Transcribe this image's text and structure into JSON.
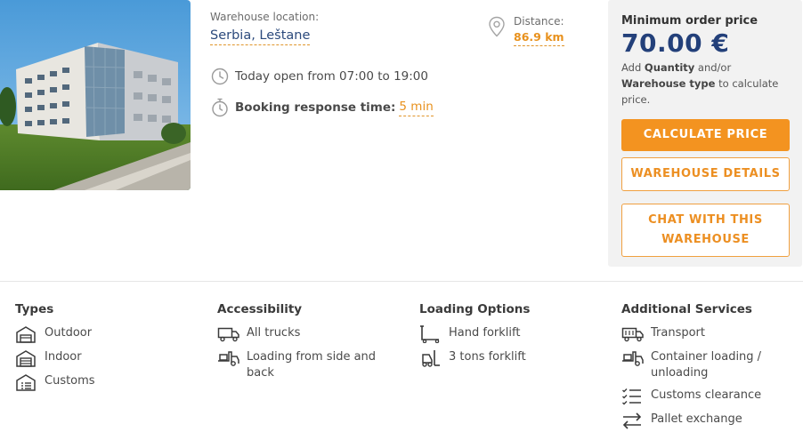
{
  "listing": {
    "location_label": "Warehouse location:",
    "location_value": "Serbia, Leštane",
    "distance_label": "Distance:",
    "distance_value": "86.9 km",
    "open_hours": "Today open from 07:00 to 19:00",
    "booking_label": "Booking response time:",
    "booking_value": "5 min",
    "icons": {
      "pin": "map-pin-icon",
      "clock": "clock-icon",
      "stopwatch": "stopwatch-icon"
    }
  },
  "pricing": {
    "min_label": "Minimum order price",
    "price": "70.00 €",
    "hint_prefix": "Add ",
    "hint_quantity": "Quantity",
    "hint_middle": " and/or ",
    "hint_type": "Warehouse type",
    "hint_suffix": " to calculate price.",
    "calculate_button": "CALCULATE PRICE",
    "details_button": "WAREHOUSE DETAILS",
    "chat_button": "CHAT WITH THIS WAREHOUSE"
  },
  "features": {
    "types": {
      "title": "Types",
      "items": [
        "Outdoor",
        "Indoor",
        "Customs"
      ]
    },
    "accessibility": {
      "title": "Accessibility",
      "items": [
        "All trucks",
        "Loading from side and back"
      ]
    },
    "loading": {
      "title": "Loading Options",
      "items": [
        "Hand forklift",
        "3 tons forklift"
      ]
    },
    "services": {
      "title": "Additional Services",
      "items": [
        "Transport",
        "Container loading / unloading",
        "Customs clearance",
        "Pallet exchange"
      ]
    }
  },
  "colors": {
    "accent": "#f39320",
    "price_blue": "#23407a",
    "link_blue": "#2c4a7c",
    "panel_bg": "#f2f2f2"
  }
}
